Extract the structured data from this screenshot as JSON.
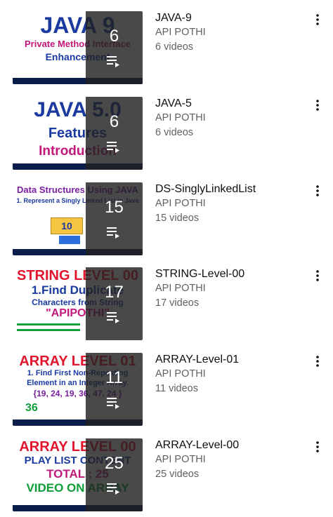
{
  "playlists": [
    {
      "title": "JAVA-9",
      "channel": "API POTHI",
      "videos": "6 videos",
      "count": "6",
      "thumb": {
        "line1": "JAVA 9",
        "line2": "Private Method Interface",
        "line3": "Enhancement",
        "bg": "#ffffff"
      }
    },
    {
      "title": "JAVA-5",
      "channel": "API POTHI",
      "videos": "6 videos",
      "count": "6",
      "thumb": {
        "line1": "JAVA 5.0",
        "line2": "Features",
        "line3": "Introduction",
        "bg": "#ffffff"
      }
    },
    {
      "title": "DS-SinglyLinkedList",
      "channel": "API POTHI",
      "videos": "15 videos",
      "count": "15",
      "thumb": {
        "line1": "Data Structures Using JAVA",
        "line2": "1. Represent a Singly Linked List in Java",
        "line3": "10",
        "bg": "#ffffff"
      }
    },
    {
      "title": "STRING-Level-00",
      "channel": "API POTHI",
      "videos": "17 videos",
      "count": "17",
      "thumb": {
        "line1": "STRING LEVEL 00",
        "line2": "1.Find Duplicate",
        "line3": "Characters from String",
        "line4": "\"APIPOTHI\"",
        "bg": "#ffffff"
      }
    },
    {
      "title": "ARRAY-Level-01",
      "channel": "API POTHI",
      "videos": "11 videos",
      "count": "11",
      "thumb": {
        "line1": "ARRAY LEVEL 01",
        "line2": "1. Find First Non-Repeating",
        "line3": "Element in an Integer Array.",
        "line4": "{19, 24, 19, 36, 47, 24 }",
        "line5": "36",
        "bg": "#ffffff"
      }
    },
    {
      "title": "ARRAY-Level-00",
      "channel": "API POTHI",
      "videos": "25 videos",
      "count": "25",
      "thumb": {
        "line1": "ARRAY LEVEL 00",
        "line2": "PLAY LIST CONTENT",
        "line3": "TOTAL : 25",
        "line4": "VIDEO ON ARRAY",
        "bg": "#ffffff"
      }
    }
  ],
  "colors": {
    "title": "#0f0f0f",
    "secondary": "#606060",
    "overlay": "#212121",
    "thumb_blue": "#1a3aa0",
    "thumb_red": "#e0142c",
    "thumb_magenta": "#c2187a",
    "thumb_green": "#0f9d3a",
    "thumb_purple": "#7a1fa2"
  },
  "icons": {
    "menu": "more-vert-icon",
    "playlist": "playlist-play-icon"
  }
}
